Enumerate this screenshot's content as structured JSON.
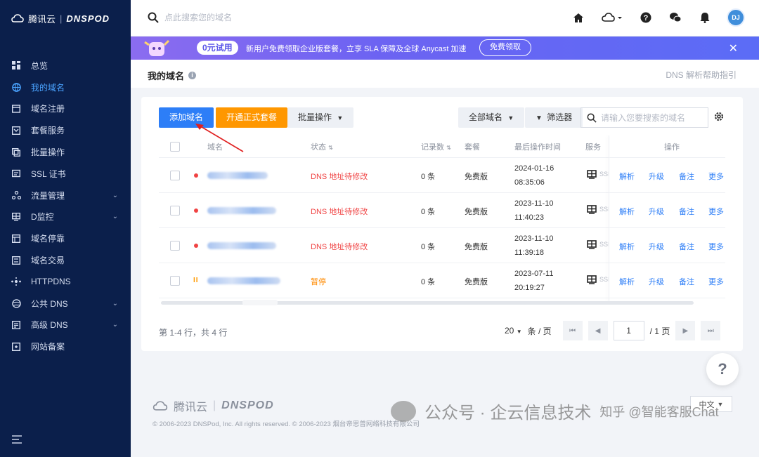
{
  "brand": {
    "cloud_name": "腾讯云",
    "product": "DNSPOD"
  },
  "sidebar": {
    "items": [
      {
        "label": "总览",
        "icon": "dashboard-icon",
        "active": false,
        "expandable": false
      },
      {
        "label": "我的域名",
        "icon": "globe-icon",
        "active": true,
        "expandable": false
      },
      {
        "label": "域名注册",
        "icon": "register-icon",
        "active": false,
        "expandable": false
      },
      {
        "label": "套餐服务",
        "icon": "package-icon",
        "active": false,
        "expandable": false
      },
      {
        "label": "批量操作",
        "icon": "copy-icon",
        "active": false,
        "expandable": false
      },
      {
        "label": "SSL 证书",
        "icon": "certificate-icon",
        "active": false,
        "expandable": false
      },
      {
        "label": "流量管理",
        "icon": "traffic-icon",
        "active": false,
        "expandable": true
      },
      {
        "label": "D监控",
        "icon": "monitor-icon",
        "active": false,
        "expandable": true
      },
      {
        "label": "域名停靠",
        "icon": "parking-icon",
        "active": false,
        "expandable": false
      },
      {
        "label": "域名交易",
        "icon": "trade-icon",
        "active": false,
        "expandable": false
      },
      {
        "label": "HTTPDNS",
        "icon": "httpdns-icon",
        "active": false,
        "expandable": false
      },
      {
        "label": "公共 DNS",
        "icon": "public-dns-icon",
        "active": false,
        "expandable": true
      },
      {
        "label": "高级 DNS",
        "icon": "advanced-dns-icon",
        "active": false,
        "expandable": true
      },
      {
        "label": "网站备案",
        "icon": "filing-icon",
        "active": false,
        "expandable": false
      }
    ]
  },
  "topbar": {
    "search_placeholder": "点此搜索您的域名"
  },
  "banner": {
    "badge": "0元试用",
    "text": "新用户免费领取企业版套餐，立享 SLA 保障及全球 Anycast 加速",
    "button": "免费领取",
    "close": "✕"
  },
  "page": {
    "title": "我的域名",
    "help_link": "DNS 解析帮助指引"
  },
  "toolbar": {
    "add_domain": "添加域名",
    "upgrade": "开通正式套餐",
    "batch": "批量操作",
    "all_domains": "全部域名",
    "filter": "筛选器",
    "search_placeholder": "请输入您要搜索的域名"
  },
  "table": {
    "headers": {
      "domain": "域名",
      "status": "状态",
      "records": "记录数",
      "plan": "套餐",
      "last_op": "最后操作时间",
      "service": "服务",
      "actions": "操作"
    },
    "rows": [
      {
        "status": "DNS 地址待修改",
        "status_color": "#f04343",
        "indicator": "dot",
        "records": "0 条",
        "plan": "免费版",
        "date": "2024-01-16",
        "time": "08:35:06",
        "ssl": "SSI"
      },
      {
        "status": "DNS 地址待修改",
        "status_color": "#f04343",
        "indicator": "dot",
        "records": "0 条",
        "plan": "免费版",
        "date": "2023-11-10",
        "time": "11:40:23",
        "ssl": "SSI"
      },
      {
        "status": "DNS 地址待修改",
        "status_color": "#f04343",
        "indicator": "dot",
        "records": "0 条",
        "plan": "免费版",
        "date": "2023-11-10",
        "time": "11:39:18",
        "ssl": "SSI"
      },
      {
        "status": "暂停",
        "status_color": "#ff8a00",
        "indicator": "pause",
        "records": "0 条",
        "plan": "免费版",
        "date": "2023-07-11",
        "time": "20:19:27",
        "ssl": "SSI"
      }
    ],
    "actions": {
      "resolve": "解析",
      "upgrade": "升级",
      "note": "备注",
      "more": "更多"
    }
  },
  "pagination": {
    "summary": "第 1-4 行，共 4 行",
    "page_size": "20",
    "per_page_unit": "条 / 页",
    "current": "1",
    "total_pages": "/ 1 页"
  },
  "footer": {
    "cloud_name": "腾讯云",
    "product": "DNSPOD",
    "copyright": "© 2006-2023 DNSPod, Inc. All rights reserved. © 2006-2023 烟台帝思普网络科技有限公司",
    "language": "中文"
  },
  "help_fab": "?",
  "watermark": {
    "part1": "公众号 · 企云信息技术",
    "part2": "知乎 @智能客服Chat"
  },
  "colors": {
    "sidebar_bg": "#0b1f4b",
    "primary": "#2d7ef7",
    "orange": "#ff9700",
    "danger": "#f04343"
  }
}
